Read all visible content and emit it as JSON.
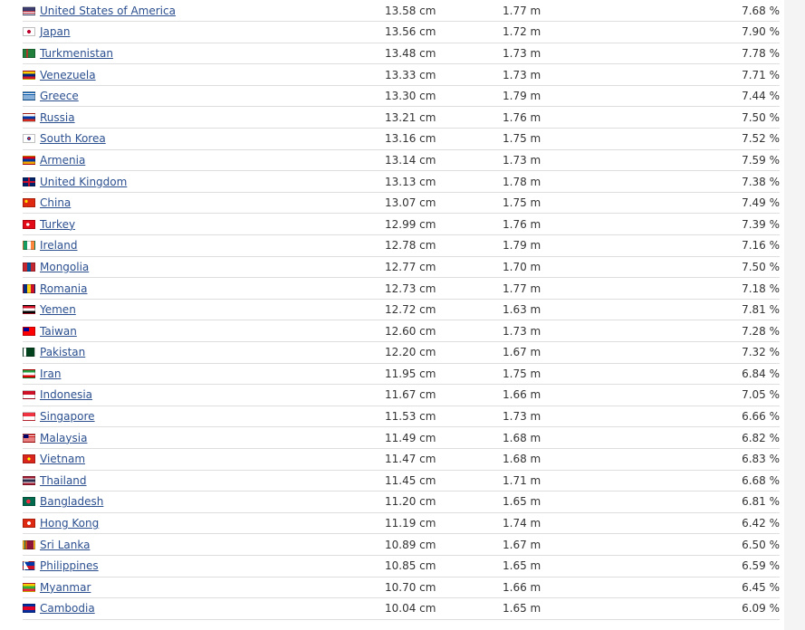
{
  "rows": [
    {
      "country": "United States of America",
      "flag": "us-flag-icon",
      "flag_style": "linear-gradient(to bottom, #3c3b6e 0%, #3c3b6e 50%, #b22234 50%, #b22234 62%, #ffffff 62%, #ffffff 75%, #b22234 75%, #b22234 87%, #ffffff 87%)",
      "penis_size": "13.58 cm",
      "height": "1.77 m",
      "percent": "7.68 %"
    },
    {
      "country": "Japan",
      "flag": "japan-flag-icon",
      "flag_style": "radial-gradient(circle at 50% 50%, #bc002d 0%, #bc002d 28%, #ffffff 30%)",
      "penis_size": "13.56 cm",
      "height": "1.72 m",
      "percent": "7.90 %"
    },
    {
      "country": "Turkmenistan",
      "flag": "turkmenistan-flag-icon",
      "flag_style": "linear-gradient(to right, #1f7f3b 0%, #1f7f3b 25%, #a83c2a 25%, #a83c2a 40%, #1f7f3b 40%)",
      "penis_size": "13.48 cm",
      "height": "1.73 m",
      "percent": "7.78 %"
    },
    {
      "country": "Venezuela",
      "flag": "venezuela-flag-icon",
      "flag_style": "linear-gradient(to bottom, #ffcc00 0%, #ffcc00 33%, #00247d 33%, #00247d 66%, #cf142b 66%)",
      "penis_size": "13.33 cm",
      "height": "1.73 m",
      "percent": "7.71 %"
    },
    {
      "country": "Greece",
      "flag": "greece-flag-icon",
      "flag_style": "repeating-linear-gradient(to bottom, #0d5eaf 0px, #0d5eaf 1.1px, #ffffff 1.1px, #ffffff 2.2px)",
      "penis_size": "13.30 cm",
      "height": "1.79 m",
      "percent": "7.44 %"
    },
    {
      "country": "Russia",
      "flag": "russia-flag-icon",
      "flag_style": "linear-gradient(to bottom, #ffffff 0%, #ffffff 33%, #0039a6 33%, #0039a6 66%, #d52b1e 66%)",
      "penis_size": "13.21 cm",
      "height": "1.76 m",
      "percent": "7.50 %"
    },
    {
      "country": "South Korea",
      "flag": "south-korea-flag-icon",
      "flag_style": "radial-gradient(circle at 50% 50%, #cd2e3a 0%, #cd2e3a 18%, #0047a0 20%, #0047a0 28%, #ffffff 30%)",
      "penis_size": "13.16 cm",
      "height": "1.75 m",
      "percent": "7.52 %"
    },
    {
      "country": "Armenia",
      "flag": "armenia-flag-icon",
      "flag_style": "linear-gradient(to bottom, #d90012 0%, #d90012 33%, #0033a0 33%, #0033a0 66%, #f2a800 66%)",
      "penis_size": "13.14 cm",
      "height": "1.73 m",
      "percent": "7.59 %"
    },
    {
      "country": "United Kingdom",
      "flag": "uk-flag-icon",
      "flag_style": "linear-gradient(to bottom, transparent 40%, #c8102e 40%, #c8102e 60%, transparent 60%), linear-gradient(to right, #012169 0%, #012169 40%, #c8102e 40%, #c8102e 60%, #012169 60%)",
      "penis_size": "13.13 cm",
      "height": "1.78 m",
      "percent": "7.38 %"
    },
    {
      "country": "China",
      "flag": "china-flag-icon",
      "flag_style": "radial-gradient(circle at 25% 30%, #ffde00 0%, #ffde00 15%, #de2910 17%)",
      "penis_size": "13.07 cm",
      "height": "1.75 m",
      "percent": "7.49 %"
    },
    {
      "country": "Turkey",
      "flag": "turkey-flag-icon",
      "flag_style": "radial-gradient(circle at 40% 50%, #ffffff 0%, #ffffff 20%, #e30a17 22%)",
      "penis_size": "12.99 cm",
      "height": "1.76 m",
      "percent": "7.39 %"
    },
    {
      "country": "Ireland",
      "flag": "ireland-flag-icon",
      "flag_style": "linear-gradient(to right, #169b62 0%, #169b62 33%, #ffffff 33%, #ffffff 66%, #ff883e 66%)",
      "penis_size": "12.78 cm",
      "height": "1.79 m",
      "percent": "7.16 %"
    },
    {
      "country": "Mongolia",
      "flag": "mongolia-flag-icon",
      "flag_style": "linear-gradient(to right, #c4272f 0%, #c4272f 33%, #015197 33%, #015197 66%, #c4272f 66%)",
      "penis_size": "12.77 cm",
      "height": "1.70 m",
      "percent": "7.50 %"
    },
    {
      "country": "Romania",
      "flag": "romania-flag-icon",
      "flag_style": "linear-gradient(to right, #002b7f 0%, #002b7f 33%, #fcd116 33%, #fcd116 66%, #ce1126 66%)",
      "penis_size": "12.73 cm",
      "height": "1.77 m",
      "percent": "7.18 %"
    },
    {
      "country": "Yemen",
      "flag": "yemen-flag-icon",
      "flag_style": "linear-gradient(to bottom, #ce1126 0%, #ce1126 33%, #ffffff 33%, #ffffff 66%, #000000 66%)",
      "penis_size": "12.72 cm",
      "height": "1.63 m",
      "percent": "7.81 %"
    },
    {
      "country": "Taiwan",
      "flag": "taiwan-flag-icon",
      "flag_style": "linear-gradient(to right, #000095 0%, #000095 50%, transparent 50%) top left / 100% 50% no-repeat, #fe0000",
      "penis_size": "12.60 cm",
      "height": "1.73 m",
      "percent": "7.28 %"
    },
    {
      "country": "Pakistan",
      "flag": "pakistan-flag-icon",
      "flag_style": "linear-gradient(to right, #ffffff 0%, #ffffff 25%, #01411c 25%)",
      "penis_size": "12.20 cm",
      "height": "1.67 m",
      "percent": "7.32 %"
    },
    {
      "country": "Iran",
      "flag": "iran-flag-icon",
      "flag_style": "linear-gradient(to bottom, #239f40 0%, #239f40 33%, #ffffff 33%, #ffffff 66%, #da0000 66%)",
      "penis_size": "11.95 cm",
      "height": "1.75 m",
      "percent": "6.84 %"
    },
    {
      "country": "Indonesia",
      "flag": "indonesia-flag-icon",
      "flag_style": "linear-gradient(to bottom, #ce1126 0%, #ce1126 50%, #ffffff 50%)",
      "penis_size": "11.67 cm",
      "height": "1.66 m",
      "percent": "7.05 %"
    },
    {
      "country": "Singapore",
      "flag": "singapore-flag-icon",
      "flag_style": "linear-gradient(to bottom, #ef3340 0%, #ef3340 50%, #ffffff 50%)",
      "penis_size": "11.53 cm",
      "height": "1.73 m",
      "percent": "6.66 %"
    },
    {
      "country": "Malaysia",
      "flag": "malaysia-flag-icon",
      "flag_style": "linear-gradient(to right, #010066 0%, #010066 45%, transparent 45%) top left / 100% 55% no-repeat, repeating-linear-gradient(to bottom, #cc0001 0px, #cc0001 1.1px, #ffffff 1.1px, #ffffff 2.2px)",
      "penis_size": "11.49 cm",
      "height": "1.68 m",
      "percent": "6.82 %"
    },
    {
      "country": "Vietnam",
      "flag": "vietnam-flag-icon",
      "flag_style": "radial-gradient(circle at 50% 50%, #ffff00 0%, #ffff00 20%, #da251d 24%)",
      "penis_size": "11.47 cm",
      "height": "1.68 m",
      "percent": "6.83 %"
    },
    {
      "country": "Thailand",
      "flag": "thailand-flag-icon",
      "flag_style": "linear-gradient(to bottom, #a51931 0%, #a51931 17%, #f4f5f8 17%, #f4f5f8 33%, #2d2a4a 33%, #2d2a4a 67%, #f4f5f8 67%, #f4f5f8 83%, #a51931 83%)",
      "penis_size": "11.45 cm",
      "height": "1.71 m",
      "percent": "6.68 %"
    },
    {
      "country": "Bangladesh",
      "flag": "bangladesh-flag-icon",
      "flag_style": "radial-gradient(circle at 45% 50%, #f42a41 0%, #f42a41 28%, #006a4e 31%)",
      "penis_size": "11.20 cm",
      "height": "1.65 m",
      "percent": "6.81 %"
    },
    {
      "country": "Hong Kong",
      "flag": "hong-kong-flag-icon",
      "flag_style": "radial-gradient(circle at 50% 50%, #ffffff 0%, #ffffff 25%, #de2910 30%)",
      "penis_size": "11.19 cm",
      "height": "1.74 m",
      "percent": "6.42 %"
    },
    {
      "country": "Sri Lanka",
      "flag": "sri-lanka-flag-icon",
      "flag_style": "linear-gradient(to right, #ffbe29 0%, #ffbe29 8%, #00534e 8%, #00534e 18%, #eb7400 18%, #eb7400 28%, #8d153a 28%, #8d153a 92%, #ffbe29 92%)",
      "penis_size": "10.89 cm",
      "height": "1.67 m",
      "percent": "6.50 %"
    },
    {
      "country": "Philippines",
      "flag": "philippines-flag-icon",
      "flag_style": "linear-gradient(60deg, #ffffff 0%, #ffffff 35%, transparent 35%), linear-gradient(to bottom, #0038a8 0%, #0038a8 50%, #ce1126 50%)",
      "penis_size": "10.85 cm",
      "height": "1.65 m",
      "percent": "6.59 %"
    },
    {
      "country": "Myanmar",
      "flag": "myanmar-flag-icon",
      "flag_style": "linear-gradient(to bottom, #fecb00 0%, #fecb00 33%, #34b233 33%, #34b233 66%, #ea2839 66%)",
      "penis_size": "10.70 cm",
      "height": "1.66 m",
      "percent": "6.45 %"
    },
    {
      "country": "Cambodia",
      "flag": "cambodia-flag-icon",
      "flag_style": "linear-gradient(to bottom, #032ea1 0%, #032ea1 25%, #e00025 25%, #e00025 75%, #032ea1 75%)",
      "penis_size": "10.04 cm",
      "height": "1.65 m",
      "percent": "6.09 %"
    }
  ]
}
